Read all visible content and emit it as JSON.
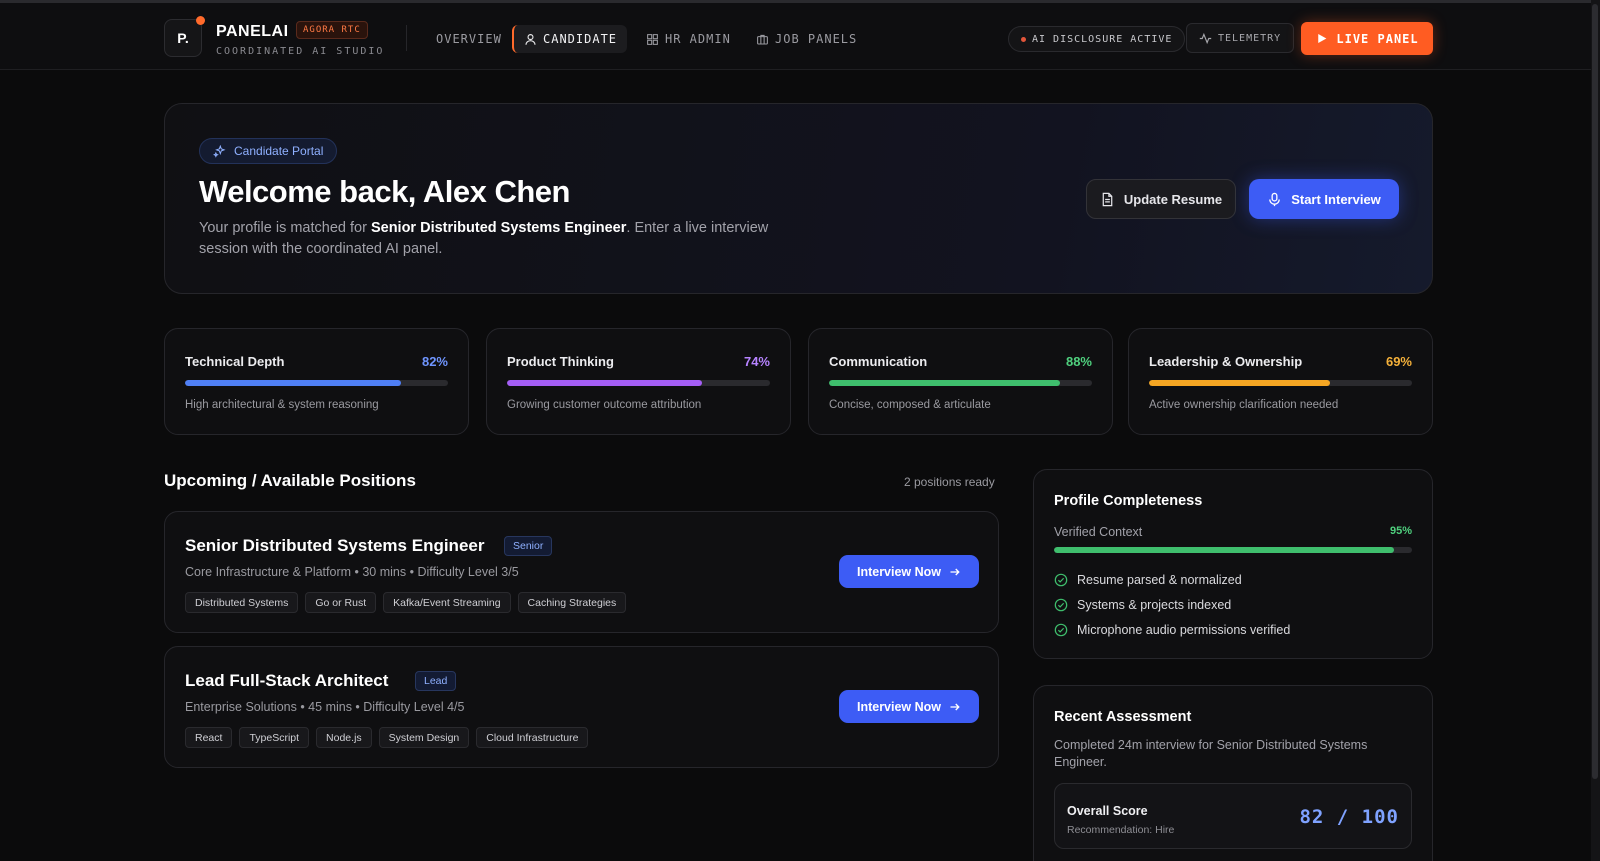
{
  "app": {
    "logo": "P.",
    "name": "PANELAI",
    "badge": "AGORA RTC",
    "subtitle": "COORDINATED AI STUDIO"
  },
  "nav": {
    "items": [
      {
        "label": "OVERVIEW",
        "icon": "none",
        "active": false
      },
      {
        "label": "CANDIDATE",
        "icon": "user-icon",
        "active": true
      },
      {
        "label": "HR ADMIN",
        "icon": "grid-icon",
        "active": false
      },
      {
        "label": "JOB PANELS",
        "icon": "briefcase-icon",
        "active": false
      }
    ]
  },
  "header": {
    "disclosure": "AI DISCLOSURE ACTIVE",
    "telemetry": "TELEMETRY",
    "live_panel": "LIVE PANEL"
  },
  "hero": {
    "pill": "Candidate Portal",
    "title": "Welcome back, Alex Chen",
    "desc_prefix": "Your profile is matched for ",
    "desc_role": "Senior Distributed Systems Engineer",
    "desc_suffix": ". Enter a live interview session with the coordinated AI panel.",
    "update_resume": "Update Resume",
    "start_interview": "Start Interview"
  },
  "metrics": [
    {
      "name": "Technical Depth",
      "value_label": "82%",
      "value": 0.82,
      "color": "#4f7ff5",
      "desc": "High architectural & system reasoning"
    },
    {
      "name": "Product Thinking",
      "value_label": "74%",
      "value": 0.74,
      "color": "#a45ef5",
      "desc": "Growing customer outcome attribution"
    },
    {
      "name": "Communication",
      "value_label": "88%",
      "value": 0.88,
      "color": "#3fbe6d",
      "desc": "Concise, composed & articulate"
    },
    {
      "name": "Leadership & Ownership",
      "value_label": "69%",
      "value": 0.69,
      "color": "#f5a623",
      "desc": "Active ownership clarification needed"
    }
  ],
  "positions": {
    "title": "Upcoming / Available Positions",
    "count": "2 positions ready",
    "jobs": [
      {
        "title": "Senior Distributed Systems Engineer",
        "level": "Senior",
        "meta": "Core Infrastructure & Platform • 30 mins • Difficulty Level 3/5",
        "tags": [
          "Distributed Systems",
          "Go or Rust",
          "Kafka/Event Streaming",
          "Caching Strategies"
        ],
        "action": "Interview Now"
      },
      {
        "title": "Lead Full-Stack Architect",
        "level": "Lead",
        "meta": "Enterprise Solutions • 45 mins • Difficulty Level 4/5",
        "tags": [
          "React",
          "TypeScript",
          "Node.js",
          "System Design",
          "Cloud Infrastructure"
        ],
        "action": "Interview Now"
      }
    ]
  },
  "profile": {
    "title": "Profile Completeness",
    "verified_label": "Verified Context",
    "verified_value_label": "95%",
    "verified_value": 0.95,
    "checks": [
      "Resume parsed & normalized",
      "Systems & projects indexed",
      "Microphone audio permissions verified"
    ]
  },
  "assessment": {
    "title": "Recent Assessment",
    "desc": "Completed 24m interview for Senior Distributed Systems Engineer.",
    "score_label": "Overall Score",
    "recommendation": "Recommendation: Hire",
    "score": "82 / 100"
  },
  "colors": {
    "accent_orange": "#ff5c22",
    "accent_blue": "#3d5cf5",
    "success_green": "#3fbe6d"
  }
}
